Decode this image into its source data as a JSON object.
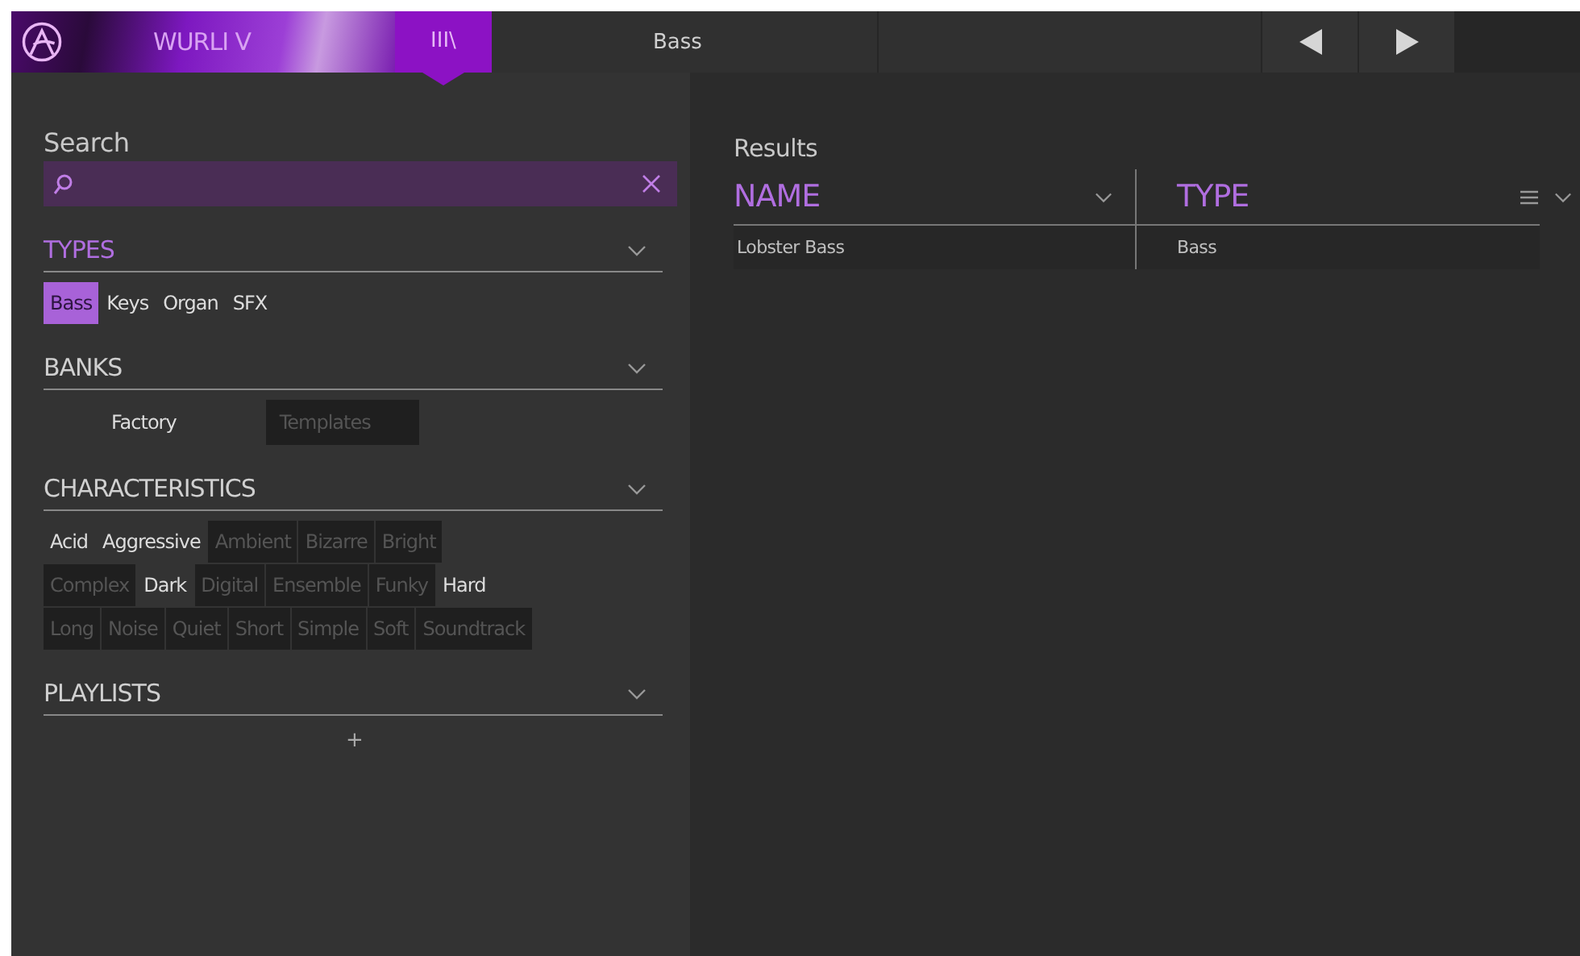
{
  "top_bar": {
    "product": "WURLI V",
    "library_tab": {
      "label": "III\\",
      "selected": true
    },
    "preset": "Bass"
  },
  "search": {
    "label": "Search"
  },
  "filters": [
    {
      "title": "TYPES",
      "active": true,
      "tags": [
        {
          "label": "Bass",
          "selected": true
        },
        {
          "label": "Keys",
          "selected": false
        },
        {
          "label": "Organ",
          "selected": false
        },
        {
          "label": "SFX",
          "selected": false
        }
      ]
    },
    {
      "title": "BANKS",
      "active": false,
      "tags": [
        {
          "label": "Factory",
          "disabled": false
        },
        {
          "label": "Templates",
          "disabled": true
        }
      ]
    },
    {
      "title": "CHARACTERISTICS",
      "active": false,
      "tags": [
        {
          "label": "Acid",
          "disabled": false
        },
        {
          "label": "Aggressive",
          "disabled": false
        },
        {
          "label": "Ambient",
          "disabled": true
        },
        {
          "label": "Bizarre",
          "disabled": true
        },
        {
          "label": "Bright",
          "disabled": true
        },
        {
          "label": "Complex",
          "disabled": true
        },
        {
          "label": "Dark",
          "disabled": false
        },
        {
          "label": "Digital",
          "disabled": true
        },
        {
          "label": "Ensemble",
          "disabled": true
        },
        {
          "label": "Funky",
          "disabled": true
        },
        {
          "label": "Hard",
          "disabled": false
        },
        {
          "label": "Long",
          "disabled": true
        },
        {
          "label": "Noise",
          "disabled": true
        },
        {
          "label": "Quiet",
          "disabled": true
        },
        {
          "label": "Short",
          "disabled": true
        },
        {
          "label": "Simple",
          "disabled": true
        },
        {
          "label": "Soft",
          "disabled": true
        },
        {
          "label": "Soundtrack",
          "disabled": true
        }
      ]
    },
    {
      "title": "PLAYLISTS",
      "active": false,
      "add": "+"
    }
  ],
  "results": {
    "title": "Results",
    "columns": [
      "NAME",
      "TYPE"
    ],
    "rows": [
      [
        "Lobster Bass",
        "Bass"
      ]
    ]
  }
}
